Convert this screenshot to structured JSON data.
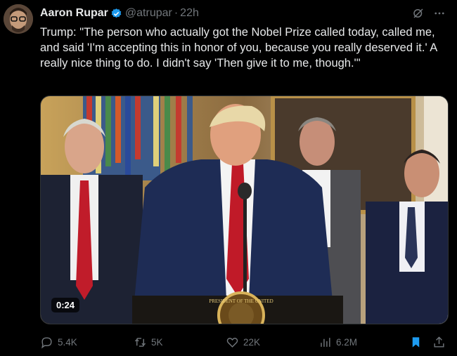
{
  "tweet": {
    "author_name": "Aaron Rupar",
    "handle": "@atrupar",
    "separator": "·",
    "time_ago": "22h",
    "text": "Trump: \"The person who actually got the Nobel Prize called today, called me, and said 'I'm accepting this in honor of you, because you really deserved it.' A really nice thing to do. I didn't say 'Then give it to me, though.'\""
  },
  "media": {
    "duration": "0:24",
    "seal_text": "PRESIDENT OF THE UNITED"
  },
  "actions": {
    "replies": "5.4K",
    "reposts": "5K",
    "likes": "22K",
    "views": "6.2M"
  },
  "colors": {
    "background": "#000000",
    "text": "#e7e9ea",
    "muted": "#71767b",
    "verified": "#1d9bf0",
    "bookmark": "#1d9bf0"
  },
  "icons": [
    "verified-badge-icon",
    "grok-icon",
    "more-icon",
    "reply-icon",
    "repost-icon",
    "like-icon",
    "views-icon",
    "bookmark-icon",
    "share-icon"
  ]
}
